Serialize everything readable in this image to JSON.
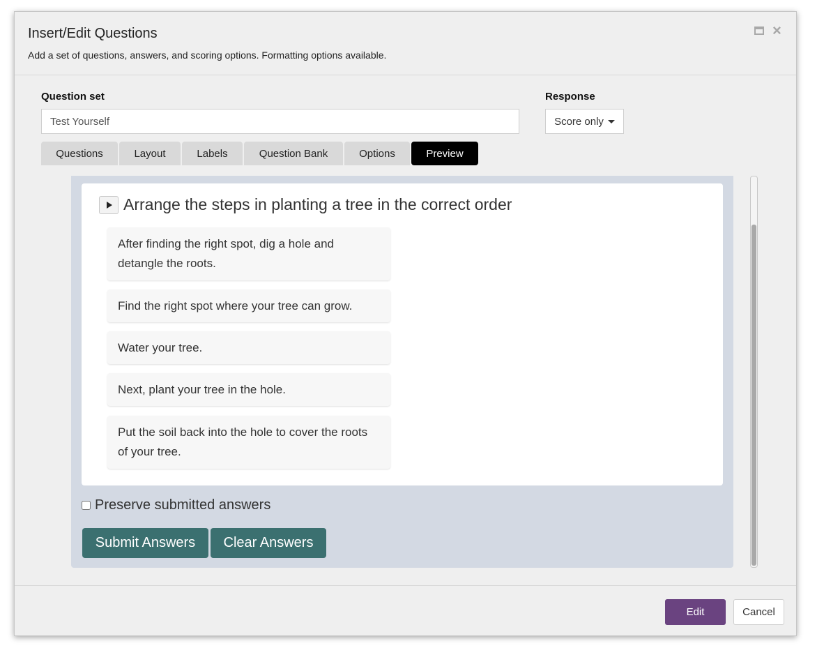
{
  "dialog": {
    "title": "Insert/Edit Questions",
    "subtitle": "Add a set of questions, answers, and scoring options. Formatting options available."
  },
  "form": {
    "question_set_label": "Question set",
    "question_set_value": "Test Yourself",
    "response_label": "Response",
    "response_value": "Score only"
  },
  "tabs": [
    {
      "label": "Questions"
    },
    {
      "label": "Layout"
    },
    {
      "label": "Labels"
    },
    {
      "label": "Question Bank"
    },
    {
      "label": "Options"
    },
    {
      "label": "Preview",
      "active": true
    }
  ],
  "preview": {
    "question": "Arrange the steps in planting a tree in the correct order",
    "steps": [
      "After finding the right spot, dig a hole and detangle the roots.",
      "Find the right spot where your tree can grow.",
      "Water your tree.",
      "Next, plant your tree in the hole.",
      "Put the soil back into the hole to cover the roots of your tree."
    ],
    "preserve_label": "Preserve submitted answers",
    "preserve_checked": false,
    "submit_label": "Submit Answers",
    "clear_label": "Clear Answers"
  },
  "footer": {
    "edit_label": "Edit",
    "cancel_label": "Cancel"
  },
  "colors": {
    "accent_purple": "#6a4380",
    "action_teal": "#3b7070",
    "preview_bg": "#d3d9e3",
    "active_tab": "#000000"
  }
}
